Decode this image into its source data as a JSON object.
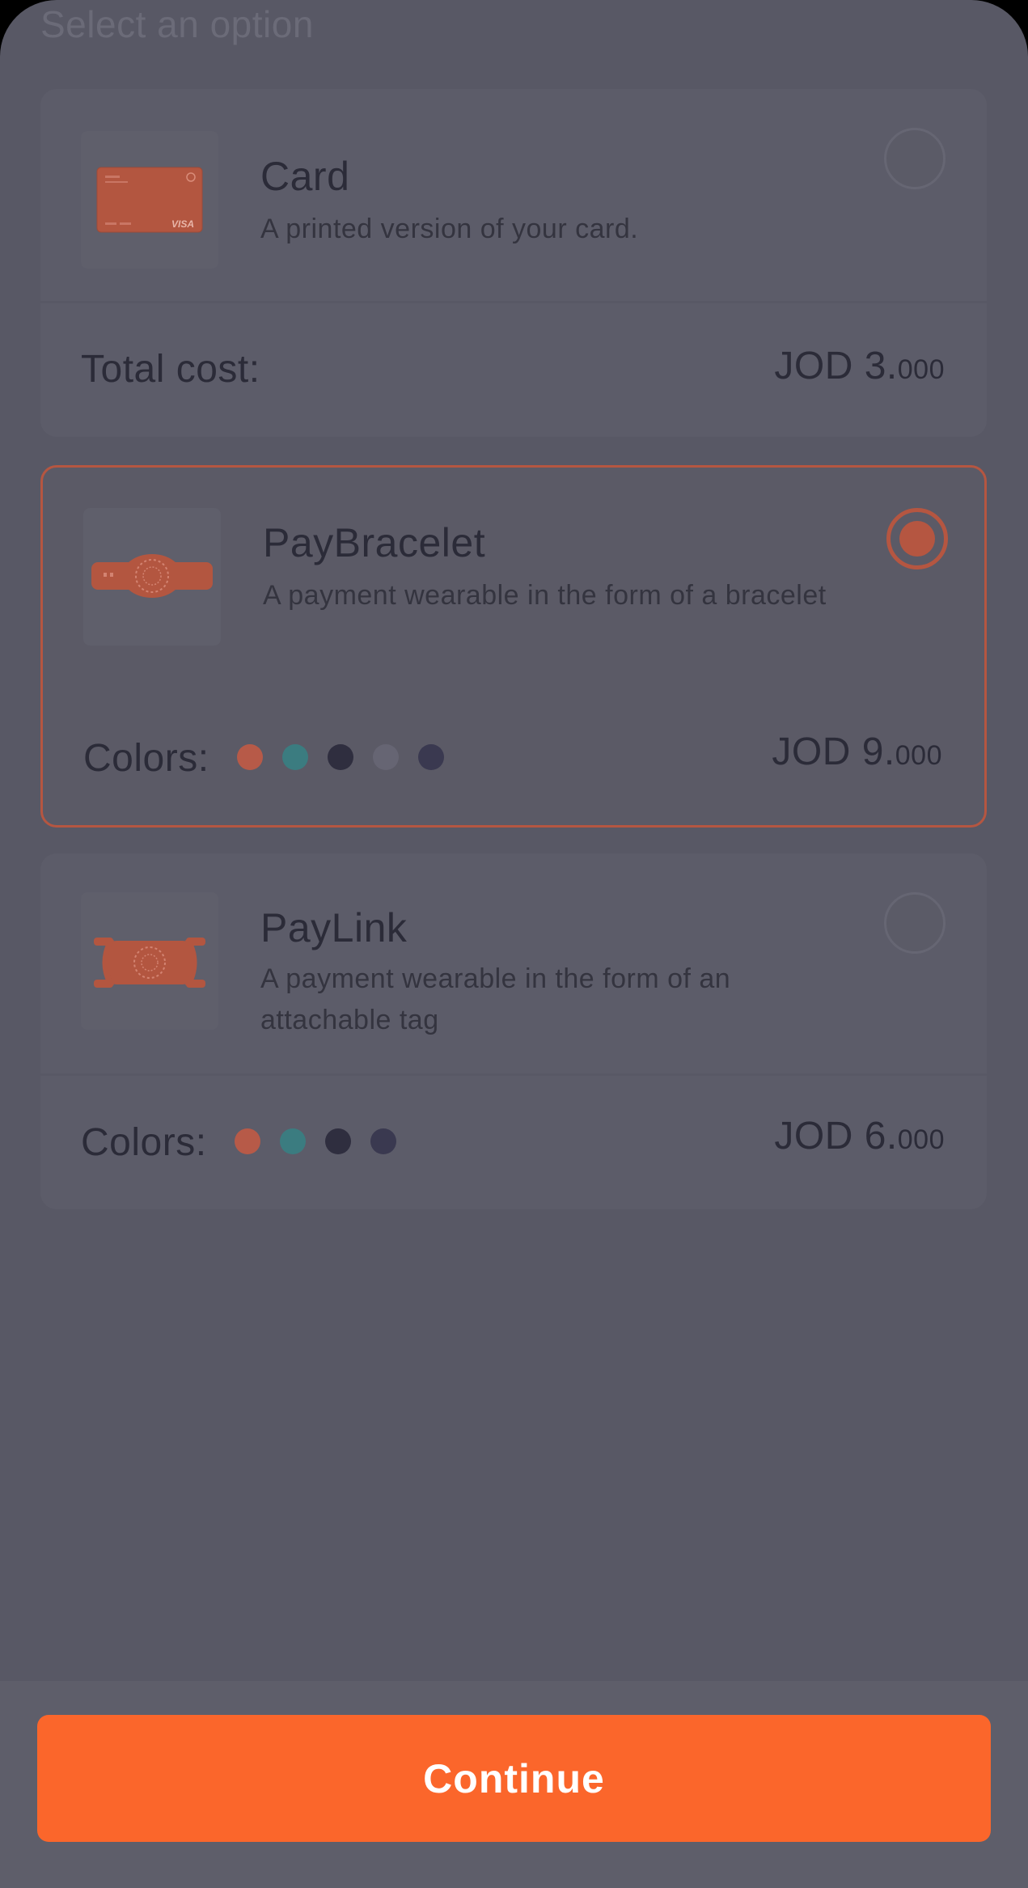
{
  "sheet": {
    "title": "Select an option"
  },
  "options": [
    {
      "name": "Card",
      "description": "A printed version of your card.",
      "selected": false,
      "footer_label": "Total cost:",
      "price_main": "JOD 3.",
      "price_decimal": "000",
      "thumb_icon": "card-image"
    },
    {
      "name": "PayBracelet",
      "description": "A payment wearable in the form of a bracelet",
      "selected": true,
      "footer_label": "Colors:",
      "colors": [
        "#b75a48",
        "#3b7c80",
        "#2f2e3f",
        "#666573",
        "#3a3950"
      ],
      "price_main": "JOD 9.",
      "price_decimal": "000",
      "thumb_icon": "bracelet-image"
    },
    {
      "name": "PayLink",
      "description": "A payment wearable in the form of an attachable tag",
      "selected": false,
      "footer_label": "Colors:",
      "colors": [
        "#b75a48",
        "#3b7c80",
        "#2f2e3f",
        "#3a3950"
      ],
      "price_main": "JOD 6.",
      "price_decimal": "000",
      "thumb_icon": "tag-image"
    }
  ],
  "footer": {
    "continue_label": "Continue"
  },
  "theme": {
    "accent": "#fb662b",
    "selected_border": "#b55641"
  }
}
